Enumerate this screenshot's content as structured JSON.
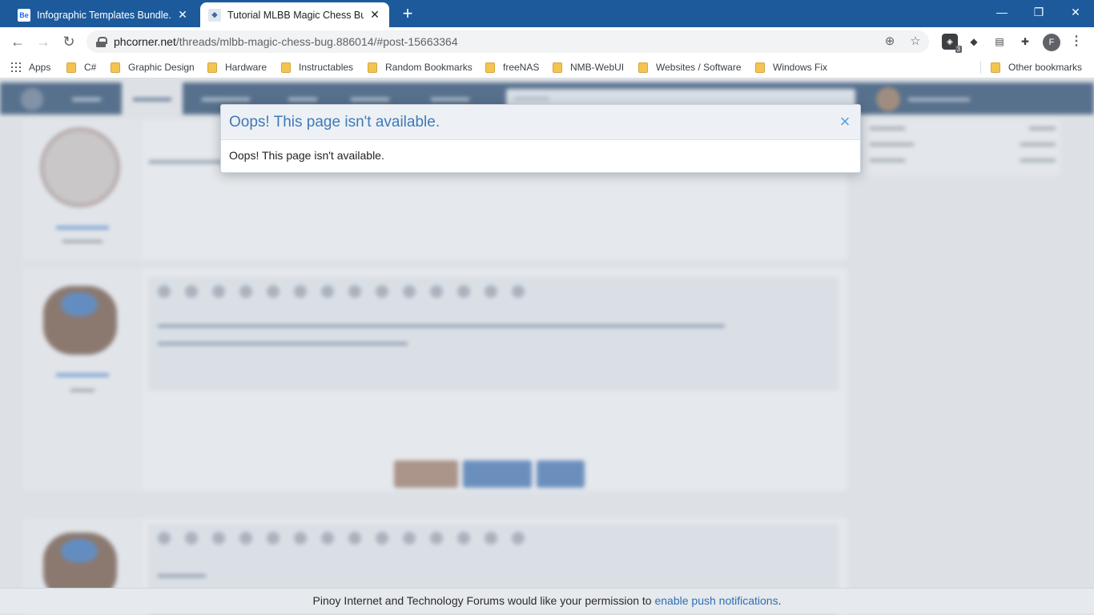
{
  "browser": {
    "tabs": [
      {
        "label": "Infographic Templates Bundle. In",
        "favicon": "Be",
        "active": false
      },
      {
        "label": "Tutorial MLBB Magic Chess Bug |",
        "favicon": "phc",
        "active": true
      }
    ],
    "new_tab": "+",
    "window_controls": {
      "minimize": "—",
      "restore": "❐",
      "close": "✕"
    },
    "url": {
      "host": "phcorner.net",
      "path": "/threads/mlbb-magic-chess-bug.886014/#post-15663364"
    },
    "profile_initial": "F",
    "extension_badge": "3",
    "bookmarks": [
      "Apps",
      "C#",
      "Graphic Design",
      "Hardware",
      "Instructables",
      "Random Bookmarks",
      "freeNAS",
      "NMB-WebUI",
      "Websites / Software",
      "Windows Fix"
    ],
    "other_bookmarks": "Other bookmarks"
  },
  "modal": {
    "title": "Oops! This page isn't available.",
    "message": "Oops! This page isn't available.",
    "close": "×"
  },
  "push_bar": {
    "text": "Pinoy Internet and Technology Forums would like your permission to ",
    "link": "enable push notifications",
    "suffix": "."
  },
  "colors": {
    "tabbar": "#1c5a9c",
    "site_nav": "#1b3f66",
    "modal_title": "#3f79b6",
    "link": "#2f6eb3"
  },
  "icons": [
    "back-arrow-icon",
    "forward-arrow-icon",
    "reload-icon",
    "lock-icon",
    "add-circle-icon",
    "star-icon",
    "puzzle-icon",
    "close-icon",
    "folder-icon",
    "apps-grid-icon"
  ]
}
